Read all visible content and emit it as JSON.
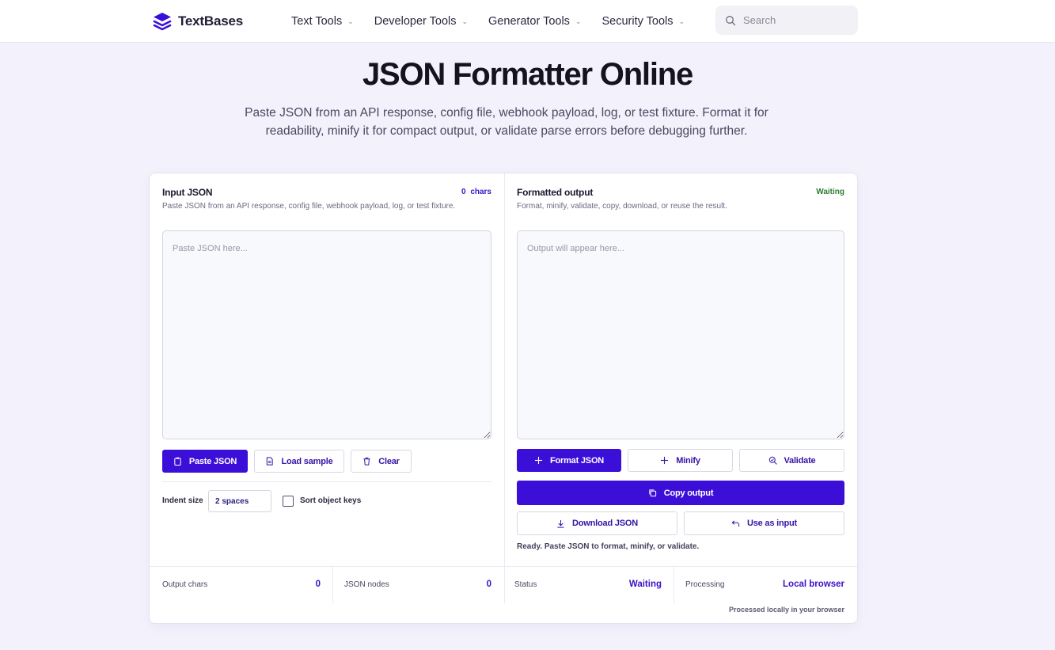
{
  "nav": {
    "brand": "TextBases",
    "menu": [
      {
        "label": "Text Tools"
      },
      {
        "label": "Developer Tools"
      },
      {
        "label": "Generator Tools"
      },
      {
        "label": "Security Tools"
      }
    ],
    "search_placeholder": "Search"
  },
  "hero": {
    "title": "JSON Formatter Online",
    "subtitle": "Paste JSON from an API response, config file, webhook payload, log, or test fixture. Format it for readability, minify it for compact output, or validate parse errors before debugging further."
  },
  "input_panel": {
    "title": "Input JSON",
    "char_count": "0",
    "char_unit": "chars",
    "description": "Paste JSON from an API response, config file, webhook payload, log, or test fixture.",
    "placeholder": "Paste JSON here...",
    "value": "",
    "buttons": {
      "paste": "Paste JSON",
      "load_sample": "Load sample",
      "clear": "Clear"
    },
    "options": {
      "indent_label": "Indent size",
      "indent_value": "2 spaces",
      "sort_keys_label": "Sort object keys",
      "sort_keys_checked": false
    }
  },
  "output_panel": {
    "title": "Formatted output",
    "status": "Waiting",
    "description": "Format, minify, validate, copy, download, or reuse the result.",
    "placeholder": "Output will appear here...",
    "value": "",
    "buttons": {
      "format": "Format JSON",
      "minify": "Minify",
      "validate": "Validate",
      "copy": "Copy output",
      "download": "Download JSON",
      "use_as_input": "Use as input"
    },
    "message": "Ready. Paste JSON to format, minify, or validate."
  },
  "stats": [
    {
      "label": "Output chars",
      "value": "0"
    },
    {
      "label": "JSON nodes",
      "value": "0"
    },
    {
      "label": "Status",
      "value": "Waiting"
    },
    {
      "label": "Processing",
      "value": "Local browser"
    }
  ],
  "footer_note": "Processed locally in your browser",
  "colors": {
    "primary": "#3b0fd8",
    "background": "#f3f2fc",
    "status_waiting": "#2e7d32"
  },
  "icons": [
    "logo-icon",
    "chevron-down-icon",
    "search-icon",
    "clipboard-icon",
    "file-icon",
    "trash-icon",
    "plus-icon",
    "validate-icon",
    "copy-icon",
    "download-icon",
    "undo-icon"
  ]
}
